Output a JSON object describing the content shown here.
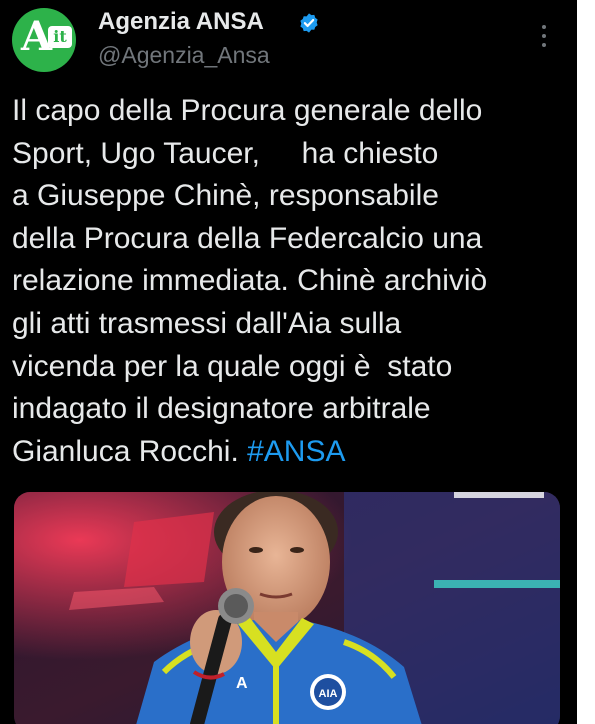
{
  "tweet": {
    "display_name": "Agenzia ANSA",
    "handle": "@Agenzia_Ansa",
    "avatar_letter": "A",
    "avatar_badge": "it",
    "verified_icon": "verified-badge-icon",
    "more_icon": "more-vertical-icon",
    "text_lines": [
      "Il capo della Procura generale dello",
      "Sport, Ugo Taucer,     ha chiesto",
      "a Giuseppe Chinè, responsabile",
      "della Procura della Federcalcio una",
      "relazione immediata. Chinè archiviò",
      "gli atti trasmessi dall'Aia sulla",
      "vicenda per la quale oggi è  stato",
      "indagato il designatore arbitrale"
    ],
    "last_line_text": "Gianluca Rocchi. ",
    "hashtag": "#ANSA",
    "media": {
      "badge_text": "AIA",
      "jacket_text": "A"
    }
  },
  "colors": {
    "background": "#000000",
    "primary_text": "#e7e9ea",
    "secondary_text": "#71767b",
    "link": "#1d9bf0",
    "avatar_green": "#2db24a",
    "jacket_blue": "#2a6fc9",
    "collar_yellow": "#d7e021"
  }
}
